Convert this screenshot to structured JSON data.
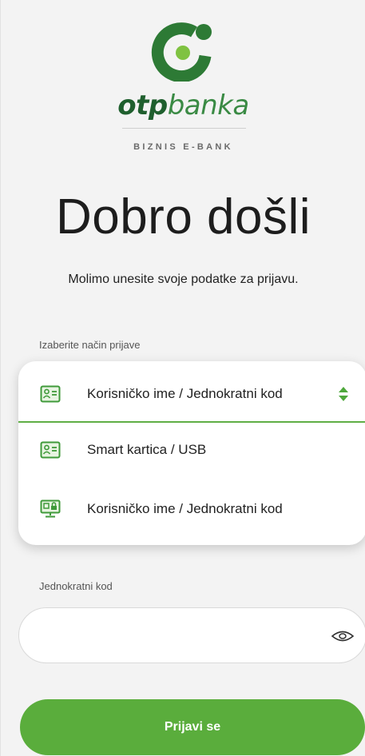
{
  "brand": {
    "name_bold": "otp",
    "name_light": "banka",
    "product": "BIZNIS E-BANK",
    "primary_color": "#2f7a3a",
    "accent_color": "#5aad3c"
  },
  "welcome": {
    "title": "Dobro došli",
    "subtitle": "Molimo unesite svoje podatke za prijavu."
  },
  "login_method": {
    "label": "Izaberite način prijave",
    "selected": {
      "icon": "id-card-icon",
      "label": "Korisničko ime / Jednokratni kod"
    },
    "options": [
      {
        "icon": "id-card-icon",
        "label": "Smart kartica / USB"
      },
      {
        "icon": "computer-lock-icon",
        "label": "Korisničko ime / Jednokratni kod"
      }
    ]
  },
  "otp_field": {
    "label": "Jednokratni kod",
    "value": "",
    "placeholder": "",
    "icon": "eye-icon"
  },
  "submit": {
    "label": "Prijavi se"
  }
}
